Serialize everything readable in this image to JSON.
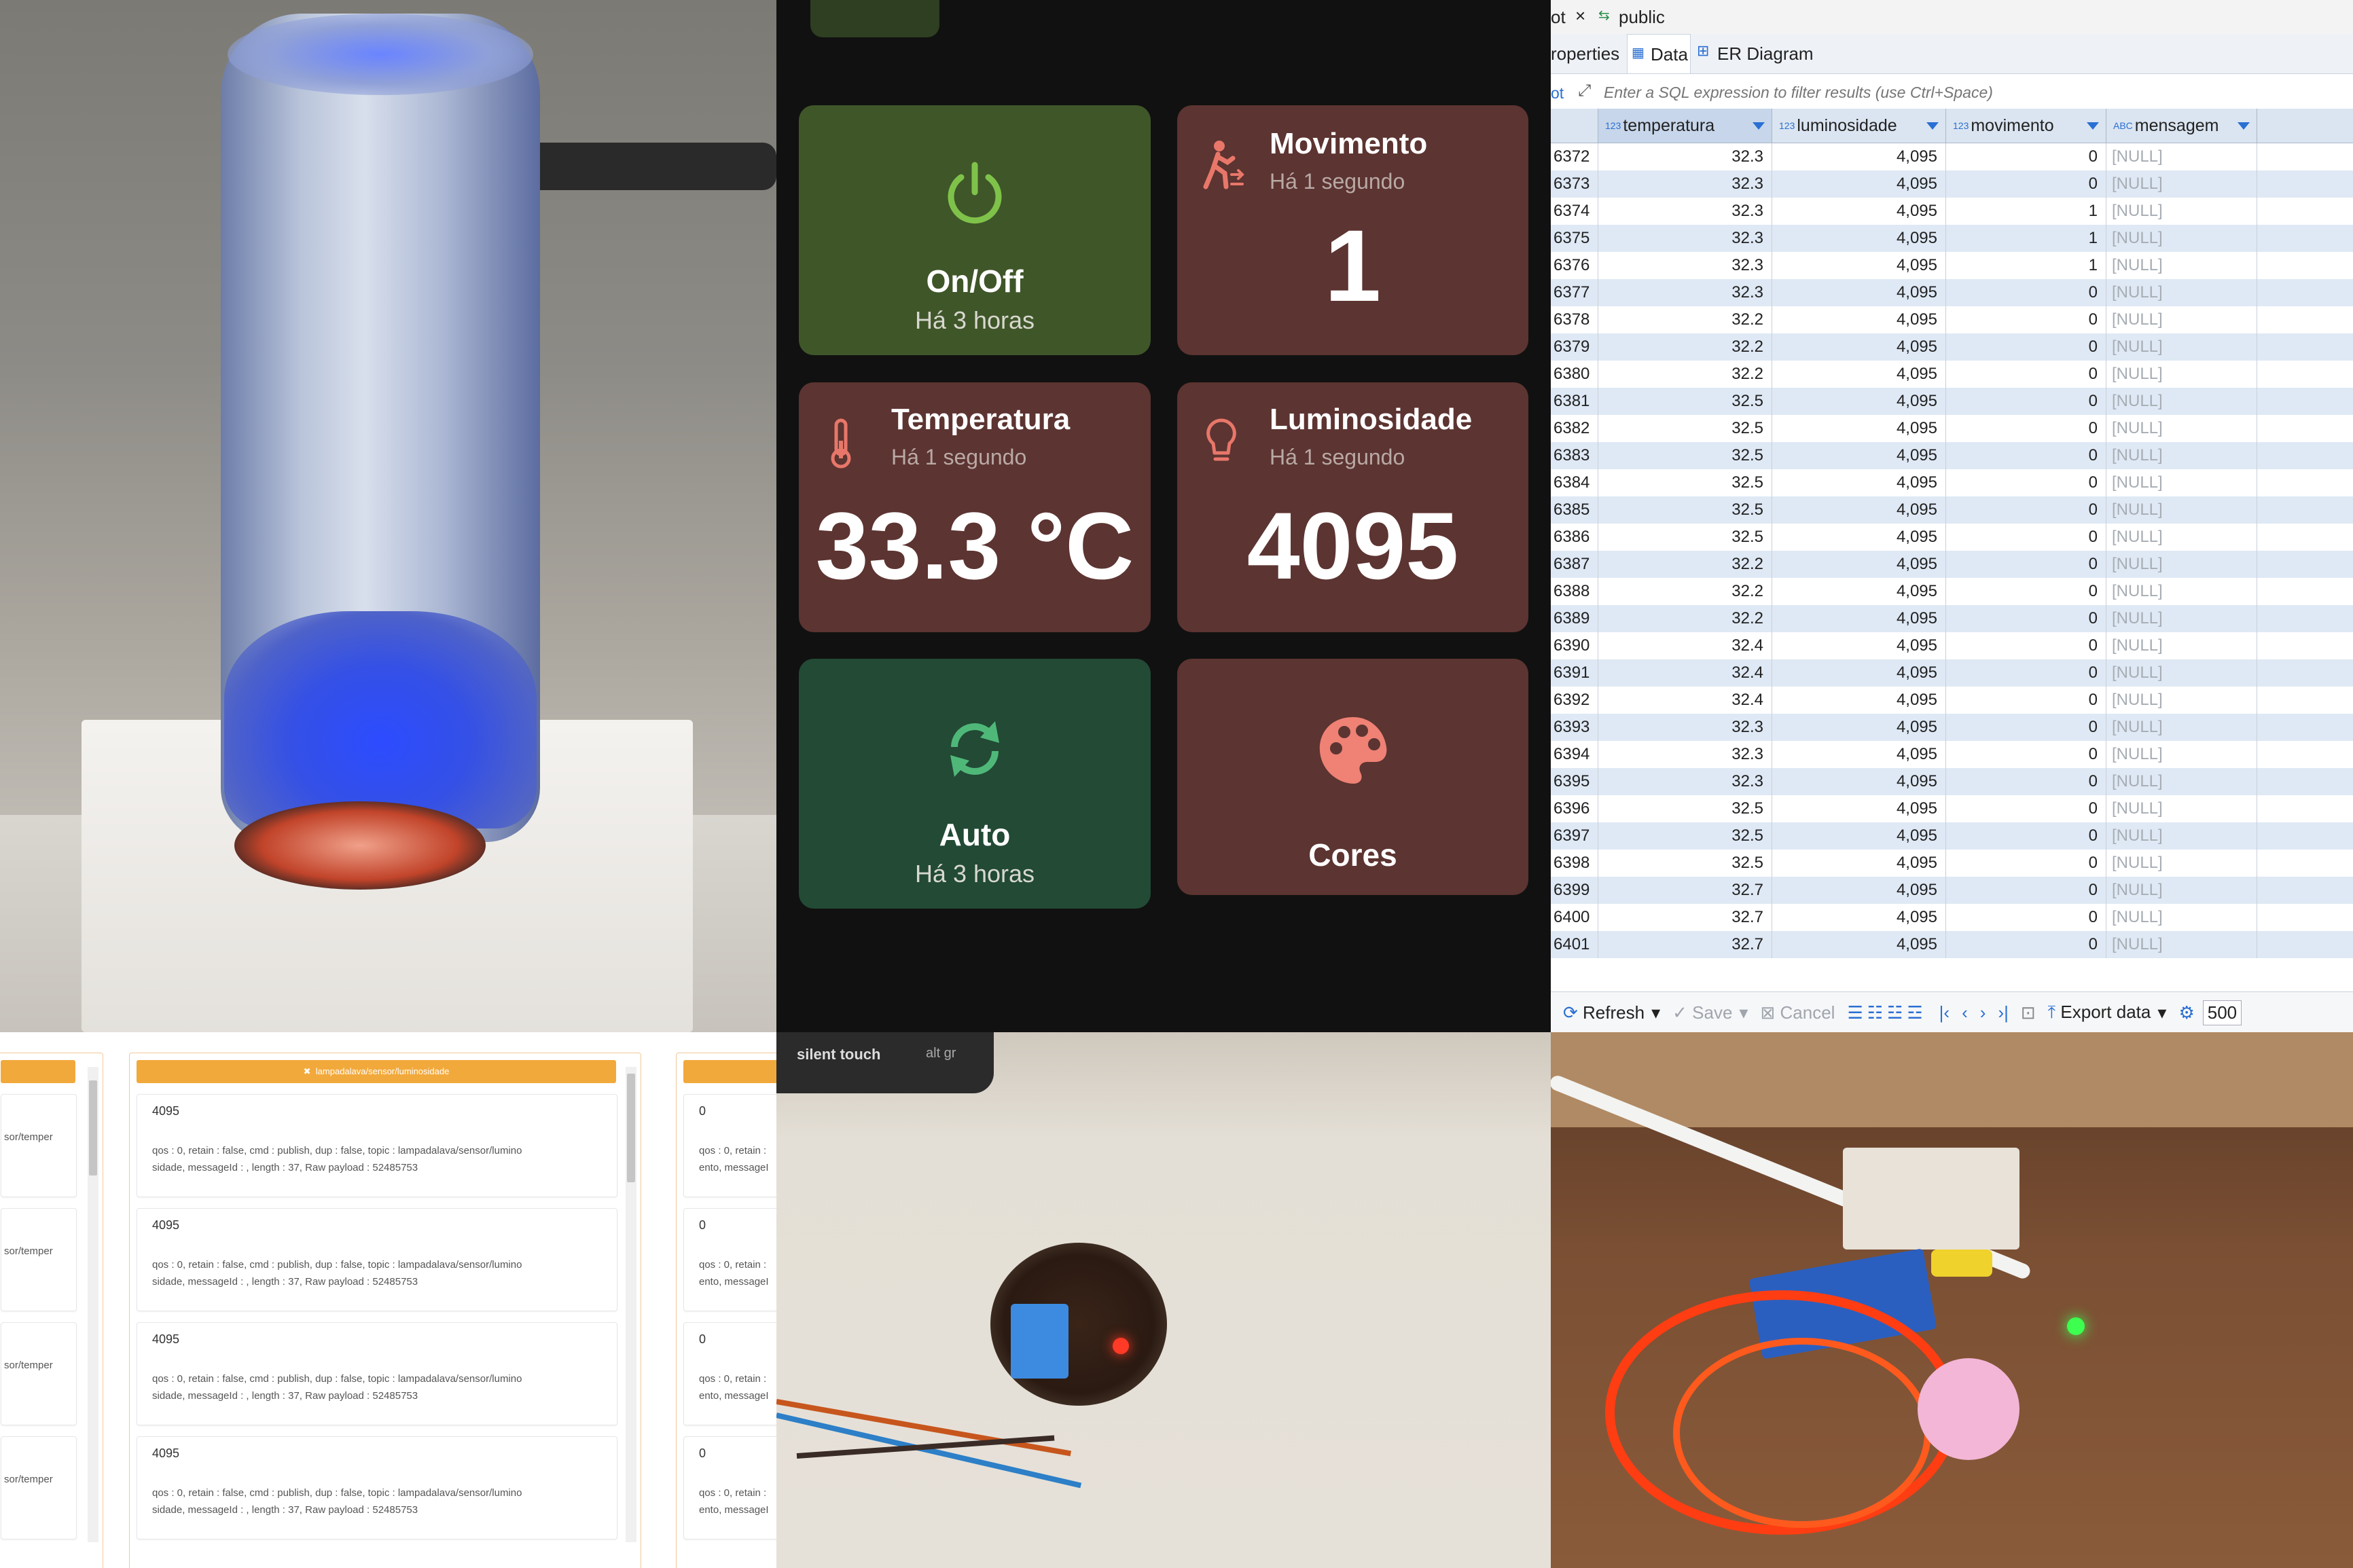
{
  "dashboard": {
    "cards": {
      "power": {
        "label": "On/Off",
        "time": "Há 3 horas",
        "color": "#3f5629",
        "icon": "power-icon"
      },
      "movement": {
        "title": "Movimento",
        "subtitle": "Há 1 segundo",
        "value": "1",
        "color": "#5c3431",
        "icon": "person-walking-icon"
      },
      "temperature": {
        "title": "Temperatura",
        "subtitle": "Há 1 segundo",
        "value": "33.3 °C",
        "color": "#5c3431",
        "icon": "thermometer-icon"
      },
      "luminosity": {
        "title": "Luminosidade",
        "subtitle": "Há 1 segundo",
        "value": "4095",
        "color": "#5c3431",
        "icon": "lightbulb-icon"
      },
      "auto": {
        "label": "Auto",
        "time": "Há 3 horas",
        "color": "#224a35",
        "icon": "sync-icon"
      },
      "colors": {
        "label": "Cores",
        "color": "#5c3431",
        "icon": "palette-icon"
      }
    }
  },
  "db": {
    "tab_fragment": "ot",
    "schema": "public",
    "subtabs": {
      "properties": "roperties",
      "data": "Data",
      "er": "ER Diagram"
    },
    "filter_prefix": "ot",
    "filter_placeholder": "Enter a SQL expression to filter results (use Ctrl+Space)",
    "columns": [
      {
        "type": "123",
        "name": "temperatura"
      },
      {
        "type": "123",
        "name": "luminosidade"
      },
      {
        "type": "123",
        "name": "movimento"
      },
      {
        "type": "ABC",
        "name": "mensagem"
      }
    ],
    "rows": [
      [
        "6372",
        "32.3",
        "4,095",
        "0",
        "[NULL]"
      ],
      [
        "6373",
        "32.3",
        "4,095",
        "0",
        "[NULL]"
      ],
      [
        "6374",
        "32.3",
        "4,095",
        "1",
        "[NULL]"
      ],
      [
        "6375",
        "32.3",
        "4,095",
        "1",
        "[NULL]"
      ],
      [
        "6376",
        "32.3",
        "4,095",
        "1",
        "[NULL]"
      ],
      [
        "6377",
        "32.3",
        "4,095",
        "0",
        "[NULL]"
      ],
      [
        "6378",
        "32.2",
        "4,095",
        "0",
        "[NULL]"
      ],
      [
        "6379",
        "32.2",
        "4,095",
        "0",
        "[NULL]"
      ],
      [
        "6380",
        "32.2",
        "4,095",
        "0",
        "[NULL]"
      ],
      [
        "6381",
        "32.5",
        "4,095",
        "0",
        "[NULL]"
      ],
      [
        "6382",
        "32.5",
        "4,095",
        "0",
        "[NULL]"
      ],
      [
        "6383",
        "32.5",
        "4,095",
        "0",
        "[NULL]"
      ],
      [
        "6384",
        "32.5",
        "4,095",
        "0",
        "[NULL]"
      ],
      [
        "6385",
        "32.5",
        "4,095",
        "0",
        "[NULL]"
      ],
      [
        "6386",
        "32.5",
        "4,095",
        "0",
        "[NULL]"
      ],
      [
        "6387",
        "32.2",
        "4,095",
        "0",
        "[NULL]"
      ],
      [
        "6388",
        "32.2",
        "4,095",
        "0",
        "[NULL]"
      ],
      [
        "6389",
        "32.2",
        "4,095",
        "0",
        "[NULL]"
      ],
      [
        "6390",
        "32.4",
        "4,095",
        "0",
        "[NULL]"
      ],
      [
        "6391",
        "32.4",
        "4,095",
        "0",
        "[NULL]"
      ],
      [
        "6392",
        "32.4",
        "4,095",
        "0",
        "[NULL]"
      ],
      [
        "6393",
        "32.3",
        "4,095",
        "0",
        "[NULL]"
      ],
      [
        "6394",
        "32.3",
        "4,095",
        "0",
        "[NULL]"
      ],
      [
        "6395",
        "32.3",
        "4,095",
        "0",
        "[NULL]"
      ],
      [
        "6396",
        "32.5",
        "4,095",
        "0",
        "[NULL]"
      ],
      [
        "6397",
        "32.5",
        "4,095",
        "0",
        "[NULL]"
      ],
      [
        "6398",
        "32.5",
        "4,095",
        "0",
        "[NULL]"
      ],
      [
        "6399",
        "32.7",
        "4,095",
        "0",
        "[NULL]"
      ],
      [
        "6400",
        "32.7",
        "4,095",
        "0",
        "[NULL]"
      ],
      [
        "6401",
        "32.7",
        "4,095",
        "0",
        "[NULL]"
      ]
    ],
    "toolbar": {
      "refresh": "Refresh",
      "save": "Save",
      "cancel": "Cancel",
      "export": "Export data",
      "page_size": "500"
    }
  },
  "mqtt": {
    "center_topic": "lampadalava/sensor/luminosidade",
    "left_fragment": "sor/temper",
    "right_value": "0",
    "right_fragment_1": "qos : 0, retain :",
    "right_fragment_2": "ento, messageI",
    "messages": [
      {
        "value": "4095",
        "line1": "qos : 0, retain : false, cmd : publish, dup : false, topic : lampadalava/sensor/lumino",
        "line2": "sidade, messageId : , length : 37, Raw payload : 52485753"
      },
      {
        "value": "4095",
        "line1": "qos : 0, retain : false, cmd : publish, dup : false, topic : lampadalava/sensor/lumino",
        "line2": "sidade, messageId : , length : 37, Raw payload : 52485753"
      },
      {
        "value": "4095",
        "line1": "qos : 0, retain : false, cmd : publish, dup : false, topic : lampadalava/sensor/lumino",
        "line2": "sidade, messageId : , length : 37, Raw payload : 52485753"
      },
      {
        "value": "4095",
        "line1": "qos : 0, retain : false, cmd : publish, dup : false, topic : lampadalava/sensor/lumino",
        "line2": "sidade, messageId : , length : 37, Raw payload : 52485753"
      }
    ],
    "accent": "#f2a93b"
  },
  "photos": {
    "keyboard_text": "silent touch",
    "keyboard_key": "alt gr"
  }
}
